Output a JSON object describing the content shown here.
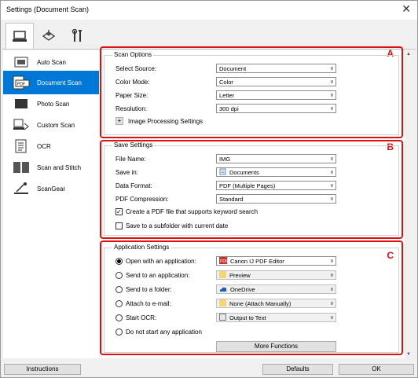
{
  "window": {
    "title": "Settings (Document Scan)"
  },
  "tabs": [
    {
      "icon": "scan-from-computer-icon"
    },
    {
      "icon": "scan-from-panel-icon"
    },
    {
      "icon": "tools-icon"
    }
  ],
  "sidebar": {
    "items": [
      {
        "label": "Auto Scan",
        "icon": "auto-scan-icon"
      },
      {
        "label": "Document Scan",
        "icon": "document-scan-icon",
        "selected": true
      },
      {
        "label": "Photo Scan",
        "icon": "photo-scan-icon"
      },
      {
        "label": "Custom Scan",
        "icon": "custom-scan-icon"
      },
      {
        "label": "OCR",
        "icon": "ocr-icon"
      },
      {
        "label": "Scan and Stitch",
        "icon": "scan-and-stitch-icon"
      },
      {
        "label": "ScanGear",
        "icon": "scangear-icon"
      }
    ]
  },
  "scan_options": {
    "title": "Scan Options",
    "marker": "A",
    "source_label": "Select Source:",
    "source": "Document",
    "color_label": "Color Mode:",
    "color": "Color",
    "paper_label": "Paper Size:",
    "paper": "Letter",
    "resolution_label": "Resolution:",
    "resolution": "300 dpi",
    "image_processing": "Image Processing Settings",
    "expand": "+"
  },
  "save_settings": {
    "title": "Save Settings",
    "marker": "B",
    "filename_label": "File Name:",
    "filename": "IMG",
    "savein_label": "Save in:",
    "savein": "Documents",
    "format_label": "Data Format:",
    "format": "PDF (Multiple Pages)",
    "compression_label": "PDF Compression:",
    "compression": "Standard",
    "keyword_search": "Create a PDF file that supports keyword search",
    "keyword_checked": true,
    "subfolder": "Save to a subfolder with current date",
    "subfolder_checked": false
  },
  "app_settings": {
    "title": "Application Settings",
    "marker": "C",
    "open_label": "Open with an application:",
    "open_value": "Canon IJ PDF Editor",
    "send_app_label": "Send to an application:",
    "send_app_value": "Preview",
    "send_folder_label": "Send to a folder:",
    "send_folder_value": "OneDrive",
    "email_label": "Attach to e-mail:",
    "email_value": "None (Attach Manually)",
    "ocr_label": "Start OCR:",
    "ocr_value": "Output to Text",
    "none_label": "Do not start any application",
    "more": "More Functions"
  },
  "footer": {
    "instructions": "Instructions",
    "defaults": "Defaults",
    "ok": "OK"
  },
  "colors": {
    "accent": "#0078d7",
    "highlight": "#e01010"
  }
}
